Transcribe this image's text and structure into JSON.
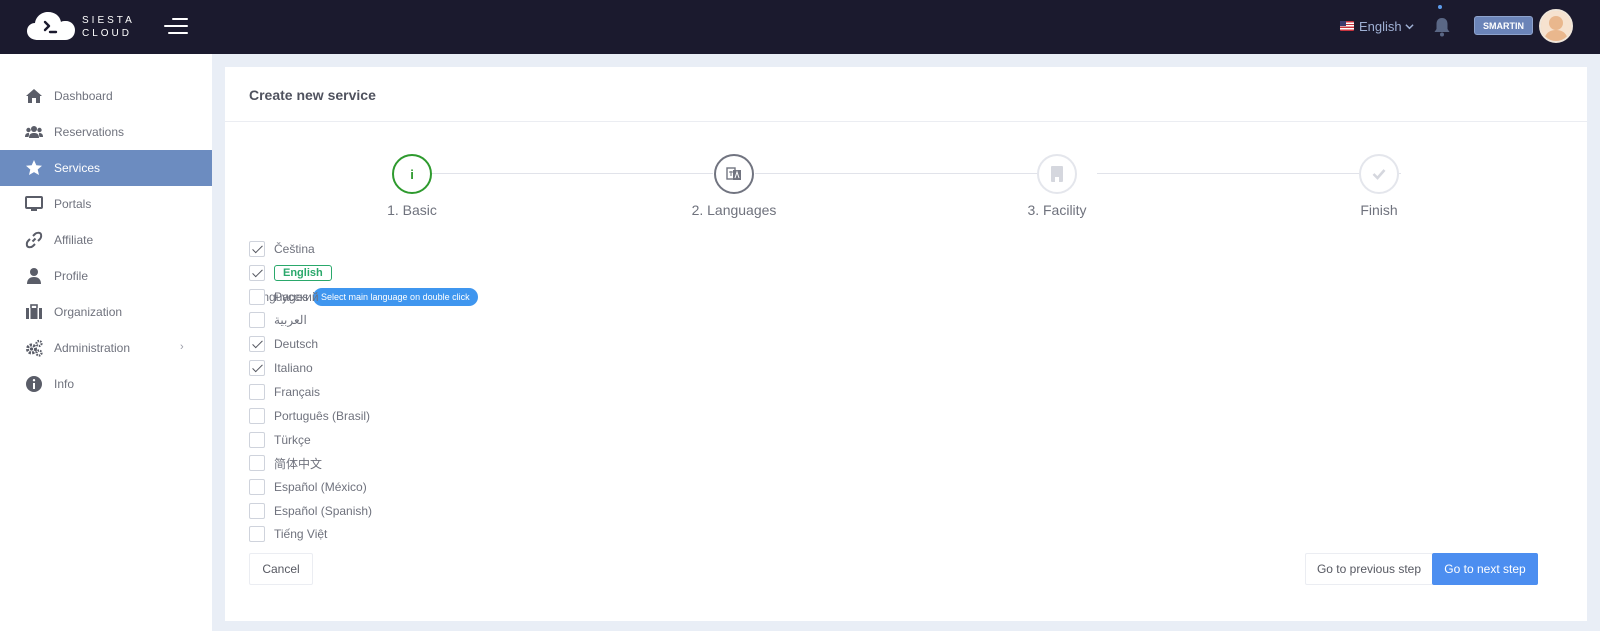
{
  "brand": {
    "line1": "SIESTA",
    "line2": "CLOUD"
  },
  "topbar": {
    "language": "English",
    "username": "SMARTIN"
  },
  "sidebar": {
    "items": [
      {
        "label": "Dashboard"
      },
      {
        "label": "Reservations"
      },
      {
        "label": "Services"
      },
      {
        "label": "Portals"
      },
      {
        "label": "Affiliate"
      },
      {
        "label": "Profile"
      },
      {
        "label": "Organization"
      },
      {
        "label": "Administration",
        "chevron": "›"
      },
      {
        "label": "Info"
      }
    ],
    "active_index": 2
  },
  "panel": {
    "title": "Create new service"
  },
  "steps": [
    {
      "label": "1. Basic",
      "icon": "info-icon",
      "glyph": "i"
    },
    {
      "label": "2. Languages",
      "icon": "translate-icon"
    },
    {
      "label": "3. Facility",
      "icon": "building-icon"
    },
    {
      "label": "Finish",
      "icon": "check-icon"
    }
  ],
  "languages_section": {
    "label": "Languages",
    "tip": "Select main language on double click",
    "items": [
      {
        "name": "Čeština",
        "checked": true
      },
      {
        "name": "English",
        "checked": true,
        "main": true
      },
      {
        "name": "Русский",
        "checked": false
      },
      {
        "name": "العربية",
        "checked": false
      },
      {
        "name": "Deutsch",
        "checked": true
      },
      {
        "name": "Italiano",
        "checked": true
      },
      {
        "name": "Français",
        "checked": false
      },
      {
        "name": "Português (Brasil)",
        "checked": false
      },
      {
        "name": "Türkçe",
        "checked": false
      },
      {
        "name": "简体中文",
        "checked": false
      },
      {
        "name": "Español (México)",
        "checked": false
      },
      {
        "name": "Español (Spanish)",
        "checked": false
      },
      {
        "name": "Tiếng Việt",
        "checked": false
      }
    ]
  },
  "buttons": {
    "cancel": "Cancel",
    "previous": "Go to previous step",
    "next": "Go to next step"
  },
  "colors": {
    "topbar": "#1b1a2e",
    "sidebar_active": "#6c8cc0",
    "step_active": "#2e9a2e",
    "primary": "#4c8ef0",
    "tip": "#3f96ef",
    "main_language": "#2aa86b"
  }
}
